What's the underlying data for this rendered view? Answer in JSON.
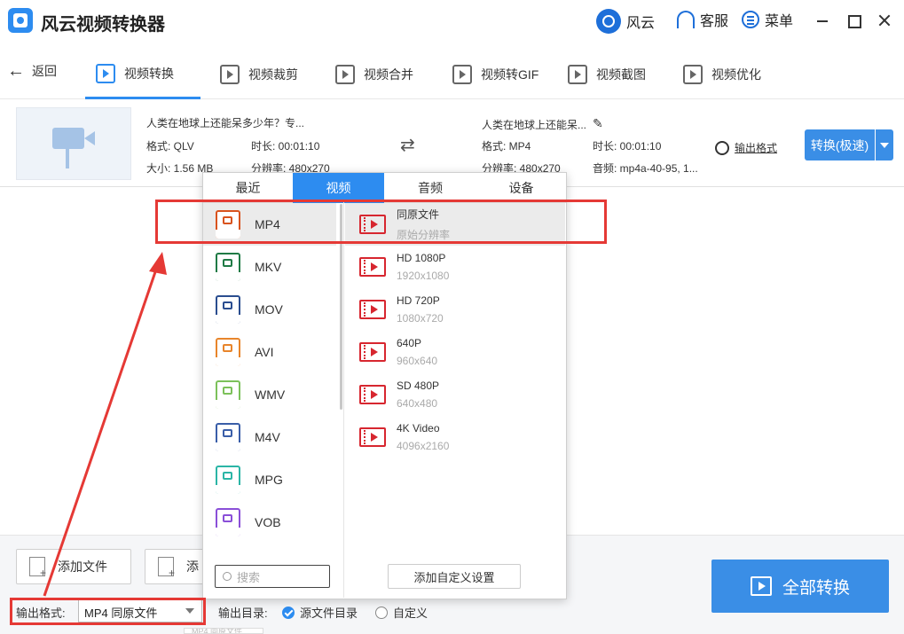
{
  "app": {
    "title": "风云视频转换器"
  },
  "titlebar": {
    "brand": "风云",
    "service": "客服",
    "menu": "菜单"
  },
  "nav": {
    "back": "返回",
    "tabs": [
      {
        "label": "视频转换",
        "icon": "video-convert-icon"
      },
      {
        "label": "视频裁剪",
        "icon": "video-crop-icon"
      },
      {
        "label": "视频合并",
        "icon": "video-merge-icon"
      },
      {
        "label": "视频转GIF",
        "icon": "gif-icon"
      },
      {
        "label": "视频截图",
        "icon": "screenshot-icon"
      },
      {
        "label": "视频优化",
        "icon": "optimize-icon"
      }
    ]
  },
  "file": {
    "source_name": "人类在地球上还能呆多少年？专...",
    "source_format": "格式: QLV",
    "source_duration": "时长: 00:01:10",
    "source_size": "大小: 1.56 MB",
    "source_resolution": "分辨率: 480x270",
    "target_name": "人类在地球上还能呆...",
    "target_format": "格式: MP4",
    "target_duration": "时长: 00:01:10",
    "target_resolution": "分辨率: 480x270",
    "target_audio": "音频: mp4a-40-95, 1...",
    "output_format_link": "输出格式",
    "convert_button": "转换(极速)"
  },
  "popup": {
    "tabs": [
      "最近",
      "视频",
      "音频",
      "设备"
    ],
    "active_tab": "视频",
    "formats": [
      {
        "name": "MP4",
        "tag": "MP4",
        "color": "#d9531e"
      },
      {
        "name": "MKV",
        "tag": "MKV",
        "color": "#1f7a45"
      },
      {
        "name": "MOV",
        "tag": "MOV",
        "color": "#2a4d8f"
      },
      {
        "name": "AVI",
        "tag": "AVI",
        "color": "#e8852b"
      },
      {
        "name": "WMV",
        "tag": "WMV",
        "color": "#7cc15a"
      },
      {
        "name": "M4V",
        "tag": "M4V",
        "color": "#3a5ea8"
      },
      {
        "name": "MPG",
        "tag": "MPG",
        "color": "#2bb5a6"
      },
      {
        "name": "VOB",
        "tag": "VOB",
        "color": "#8a4fd8"
      }
    ],
    "resolutions": [
      {
        "name": "同原文件",
        "sub": "原始分辨率"
      },
      {
        "name": "HD 1080P",
        "sub": "1920x1080"
      },
      {
        "name": "HD 720P",
        "sub": "1080x720"
      },
      {
        "name": "640P",
        "sub": "960x640"
      },
      {
        "name": "SD 480P",
        "sub": "640x480"
      },
      {
        "name": "4K Video",
        "sub": "4096x2160"
      }
    ],
    "search_placeholder": "搜索",
    "custom_button": "添加自定义设置"
  },
  "bottom": {
    "add_file": "添加文件",
    "add_folder_partial": "添",
    "output_format_label": "输出格式:",
    "output_format_value": "MP4 同原文件",
    "output_dir_label": "输出目录:",
    "radio_source": "源文件目录",
    "radio_custom": "自定义",
    "convert_all": "全部转换",
    "tooltip_partial": "MP4 同原文件"
  },
  "colors": {
    "accent": "#2d8cf0",
    "annotation": "#e53935"
  }
}
